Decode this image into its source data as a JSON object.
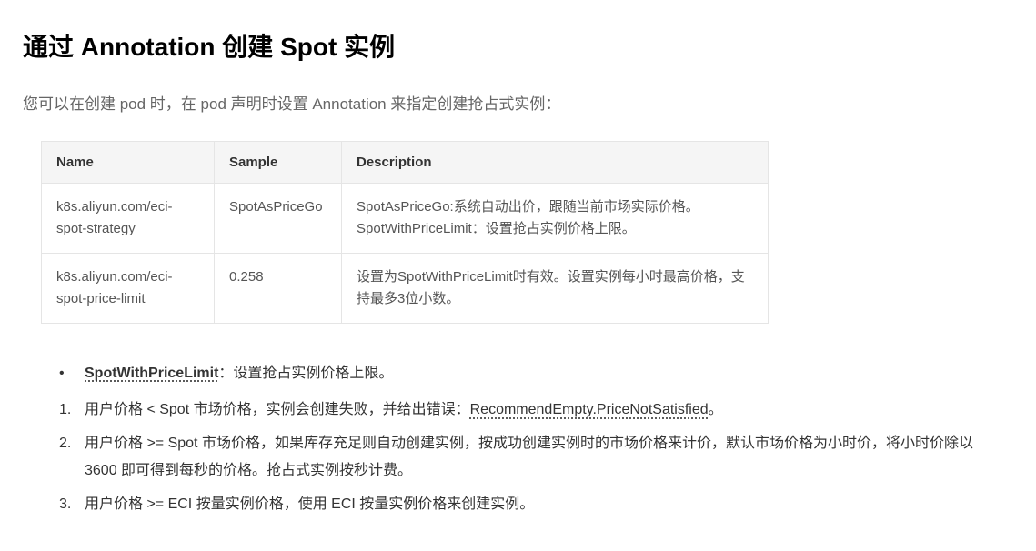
{
  "heading": "通过 Annotation 创建 Spot 实例",
  "intro": "您可以在创建 pod 时，在 pod 声明时设置 Annotation 来指定创建抢占式实例：",
  "table": {
    "headers": [
      "Name",
      "Sample",
      "Description"
    ],
    "rows": [
      {
        "name": "k8s.aliyun.com/eci-spot-strategy",
        "sample": "SpotAsPriceGo",
        "description": "SpotAsPriceGo:系统自动出价，跟随当前市场实际价格。SpotWithPriceLimit：设置抢占实例价格上限。"
      },
      {
        "name": "k8s.aliyun.com/eci-spot-price-limit",
        "sample": "0.258",
        "description": "设置为SpotWithPriceLimit时有效。设置实例每小时最高价格，支持最多3位小数。"
      }
    ]
  },
  "bullet": {
    "label": "SpotWithPriceLimit",
    "rest": "：设置抢占实例价格上限。"
  },
  "items": [
    {
      "num": "1.",
      "pre": "用户价格 < Spot 市场价格，实例会创建失败，并给出错误：",
      "err": "RecommendEmpty.PriceNotSatisfied",
      "post": "。"
    },
    {
      "num": "2.",
      "text": "用户价格 >= Spot 市场价格，如果库存充足则自动创建实例，按成功创建实例时的市场价格来计价，默认市场价格为小时价，将小时价除以 3600 即可得到每秒的价格。抢占式实例按秒计费。"
    },
    {
      "num": "3.",
      "text": "用户价格 >= ECI 按量实例价格，使用 ECI 按量实例价格来创建实例。"
    }
  ]
}
